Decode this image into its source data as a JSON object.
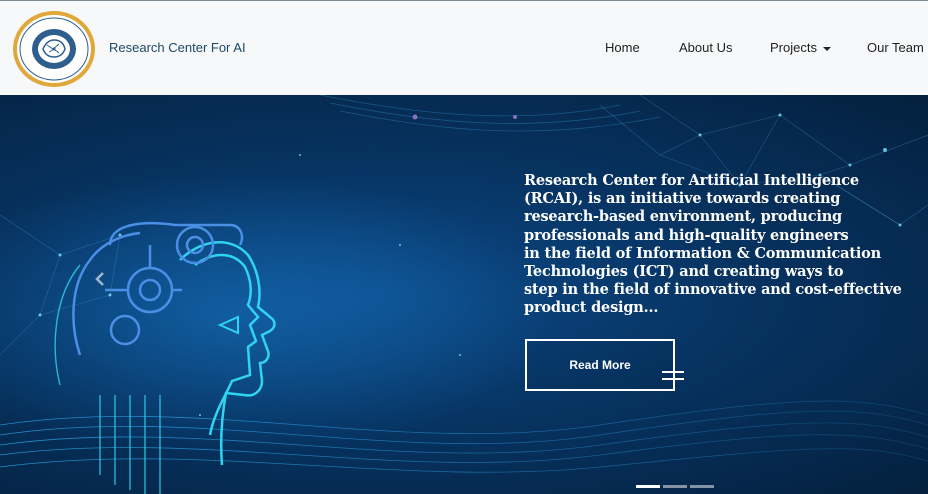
{
  "brand": {
    "name": "Research Center For AI",
    "logo_icon": "research-center-logo-icon"
  },
  "nav": {
    "items": [
      {
        "label": "Home"
      },
      {
        "label": "About Us"
      },
      {
        "label": "Projects",
        "has_dropdown": true
      },
      {
        "label": "Our Team"
      }
    ]
  },
  "hero": {
    "text": "Research Center for Artificial Intelligence\n(RCAI), is an initiative towards creating\nresearch-based environment, producing\nprofessionals and high-quality engineers\nin the field of Information & Communication\nTechnologies (ICT) and creating ways to\nstep in the field of innovative and cost-effective\nproduct design...",
    "button_label": "Read More",
    "prev_icon": "chevron-left-icon",
    "menu_icon": "hamburger-menu-icon",
    "slide_count": 3,
    "active_slide": 1
  },
  "colors": {
    "navbar_bg": "#f7f8f9",
    "hero_bg": "#073463",
    "accent_cyan": "#29d3ee",
    "logo_ring": "#e0a83a"
  }
}
